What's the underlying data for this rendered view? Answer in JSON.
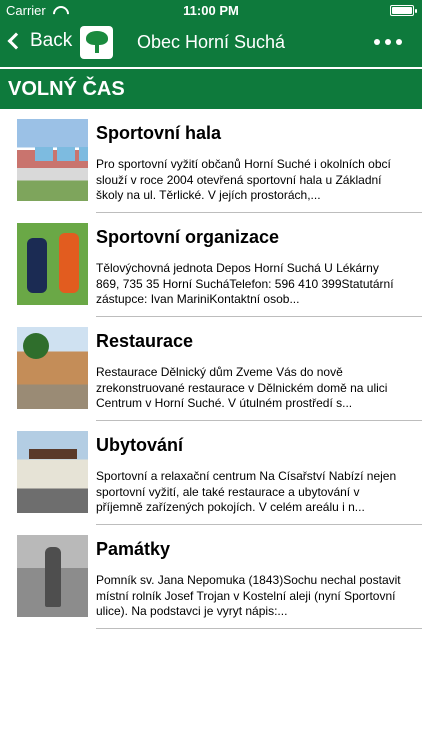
{
  "status": {
    "carrier": "Carrier",
    "time": "11:00 PM"
  },
  "nav": {
    "back_label": "Back",
    "title": "Obec Horní Suchá"
  },
  "section": {
    "title": "VOLNÝ ČAS"
  },
  "items": [
    {
      "title": "Sportovní hala",
      "text": "Pro sportovní vyžití občanů Horní Suché i okolních obcí slouží v roce 2004 otevřená sportovní hala u Základní školy na ul. Těrlické. V jejích prostorách,..."
    },
    {
      "title": "Sportovní organizace",
      "text": "Tělovýchovná jednota Depos Horní Suchá  U Lékárny 869, 735 35 Horní SucháTelefon: 596 410 399Statutární zástupce: Ivan MariniKontaktní osob..."
    },
    {
      "title": "Restaurace",
      "text": "Restaurace Dělnický dům  Zveme Vás do nově zrekonstruované restaurace v Dělnickém domě na ulici Centrum v Horní Suché. V útulném prostředí s..."
    },
    {
      "title": "Ubytování",
      "text": "Sportovní a relaxační centrum Na Císařství  Nabízí nejen sportovní vyžití, ale také restaurace a ubytování v příjemně zařízených pokojích.  V celém areálu i n..."
    },
    {
      "title": "Památky",
      "text": "Pomník sv. Jana Nepomuka (1843)Sochu nechal postavit místní rolník Josef Trojan v Kostelní aleji (nyní Sportovní ulice). Na podstavci je vyryt nápis:..."
    }
  ],
  "colors": {
    "header": "#0e7a3c"
  },
  "icons": [
    "wifi-icon",
    "battery-icon",
    "chevron-left-icon",
    "village-logo-icon",
    "more-icon"
  ]
}
